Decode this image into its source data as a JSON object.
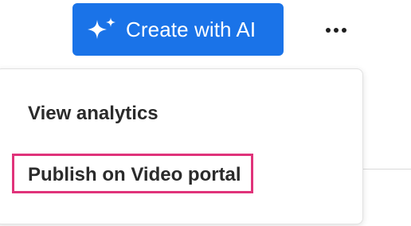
{
  "toolbar": {
    "create_ai_label": "Create with AI",
    "create_ai_icon": "sparkle-icon",
    "more_icon": "more-horizontal-icon"
  },
  "menu": {
    "items": [
      {
        "label": "View analytics"
      },
      {
        "label": "Publish on Video portal",
        "highlighted": true
      }
    ]
  },
  "colors": {
    "accent": "#1a73e8",
    "highlight_border": "#e0337a",
    "text": "#2b2b2b"
  }
}
